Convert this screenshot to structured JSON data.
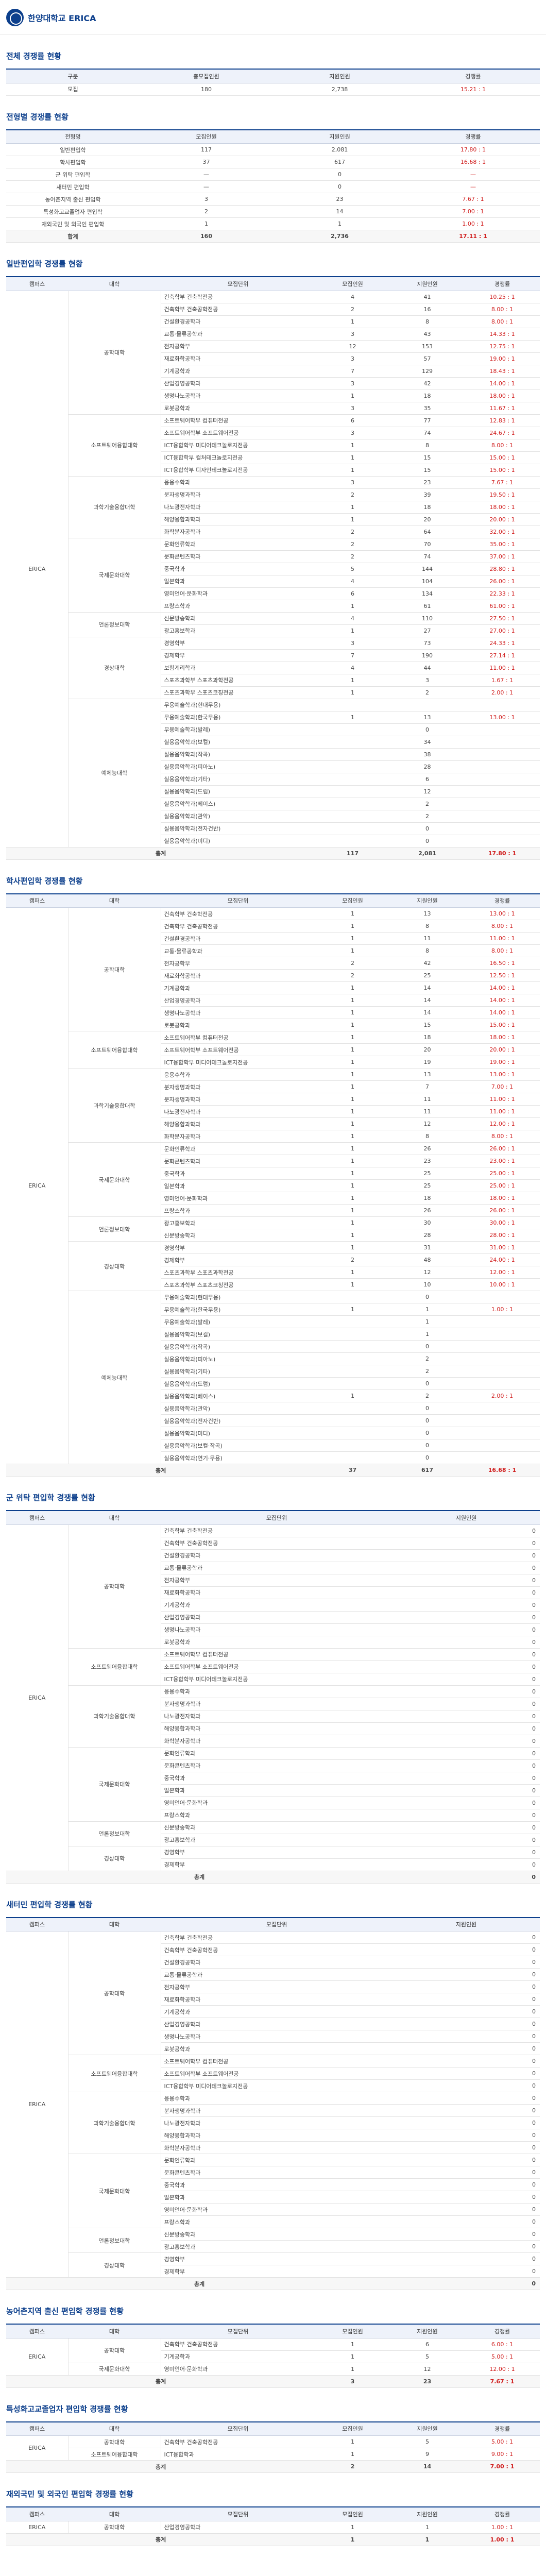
{
  "brand": {
    "name": "한양대학교 ERICA"
  },
  "s1": {
    "title": "전체 경쟁률 현황",
    "headers": [
      "구분",
      "총모집인원",
      "지원인원",
      "경쟁률"
    ],
    "rows": [
      [
        "모집",
        "180",
        "2,738",
        "15.21 : 1"
      ]
    ]
  },
  "s2": {
    "title": "전형별 경쟁률 현황",
    "headers": [
      "전형명",
      "모집인원",
      "지원인원",
      "경쟁률"
    ],
    "rows": [
      [
        "일반편입학",
        "117",
        "2,081",
        "17.80 : 1"
      ],
      [
        "학사편입학",
        "37",
        "617",
        "16.68 : 1"
      ],
      [
        "군 위탁 편입학",
        "—",
        "0",
        "—"
      ],
      [
        "새터민 편입학",
        "—",
        "0",
        "—"
      ],
      [
        "농어촌지역 출신 편입학",
        "3",
        "23",
        "7.67 : 1"
      ],
      [
        "특성화고교졸업자 편입학",
        "2",
        "14",
        "7.00 : 1"
      ],
      [
        "재외국민 및 외국인 편입학",
        "1",
        "1",
        "1.00 : 1"
      ]
    ],
    "total": [
      "합계",
      "160",
      "2,736",
      "17.11 : 1"
    ]
  },
  "s3": {
    "title": "일반편입학 경쟁률 현황",
    "headers": [
      "캠퍼스",
      "대학",
      "모집단위",
      "모집인원",
      "지원인원",
      "경쟁률"
    ]
  },
  "s4": {
    "title": "학사편입학 경쟁률 현황",
    "headers": [
      "캠퍼스",
      "대학",
      "모집단위",
      "모집인원",
      "지원인원",
      "경쟁률"
    ]
  },
  "s5": {
    "title": "군 위탁 편입학 경쟁률 현황",
    "headers": [
      "캠퍼스",
      "대학",
      "모집단위",
      "지원인원"
    ]
  },
  "s6": {
    "title": "새터민 편입학 경쟁률 현황",
    "headers": [
      "캠퍼스",
      "대학",
      "모집단위",
      "지원인원"
    ]
  },
  "s7": {
    "title": "농어촌지역 출신 편입학 경쟁률 현황",
    "headers": [
      "캠퍼스",
      "대학",
      "모집단위",
      "모집인원",
      "지원인원",
      "경쟁률"
    ],
    "rows": [
      [
        "ERICA",
        "공학대학",
        "건축학부 건축공학전공",
        "1",
        "6",
        "6.00 : 1"
      ],
      [
        "",
        "",
        "기계공학과",
        "1",
        "5",
        "5.00 : 1"
      ],
      [
        "",
        "국제문화대학",
        "영미언어·문화학과",
        "1",
        "12",
        "12.00 : 1"
      ]
    ],
    "total": [
      "총계",
      "",
      "",
      "3",
      "23",
      "7.67 : 1"
    ]
  },
  "s8": {
    "title": "특성화고교졸업자 편입학 경쟁률 현황",
    "headers": [
      "캠퍼스",
      "대학",
      "모집단위",
      "모집인원",
      "지원인원",
      "경쟁률"
    ],
    "rows": [
      [
        "ERICA",
        "공학대학",
        "건축학부 건축공학전공",
        "1",
        "5",
        "5.00 : 1"
      ],
      [
        "",
        "소프트웨어융합대학",
        "ICT융합학과",
        "1",
        "9",
        "9.00 : 1"
      ]
    ],
    "total": [
      "총계",
      "",
      "",
      "2",
      "14",
      "7.00 : 1"
    ]
  },
  "s9": {
    "title": "재외국민 및 외국인 편입학 경쟁률 현황",
    "headers": [
      "캠퍼스",
      "대학",
      "모집단위",
      "모집인원",
      "지원인원",
      "경쟁률"
    ],
    "rows": [
      [
        "ERICA",
        "공학대학",
        "산업경영공학과",
        "1",
        "1",
        "1.00 : 1"
      ]
    ],
    "total": [
      "총계",
      "",
      "",
      "1",
      "1",
      "1.00 : 1"
    ]
  },
  "campus": "ERICA",
  "total_label": "총계",
  "general": [
    [
      "공학대학",
      "건축학부 건축학전공",
      "4",
      "41",
      "10.25 : 1"
    ],
    [
      "",
      "건축학부 건축공학전공",
      "2",
      "16",
      "8.00 : 1"
    ],
    [
      "",
      "건설환경공학과",
      "1",
      "8",
      "8.00 : 1"
    ],
    [
      "",
      "교통·물류공학과",
      "3",
      "43",
      "14.33 : 1"
    ],
    [
      "",
      "전자공학부",
      "12",
      "153",
      "12.75 : 1"
    ],
    [
      "",
      "재료화학공학과",
      "3",
      "57",
      "19.00 : 1"
    ],
    [
      "",
      "기계공학과",
      "7",
      "129",
      "18.43 : 1"
    ],
    [
      "",
      "산업경영공학과",
      "3",
      "42",
      "14.00 : 1"
    ],
    [
      "",
      "생명나노공학과",
      "1",
      "18",
      "18.00 : 1"
    ],
    [
      "",
      "로봇공학과",
      "3",
      "35",
      "11.67 : 1"
    ],
    [
      "소프트웨어융합대학",
      "소프트웨어학부 컴퓨터전공",
      "6",
      "77",
      "12.83 : 1"
    ],
    [
      "",
      "소프트웨어학부 소프트웨어전공",
      "3",
      "74",
      "24.67 : 1"
    ],
    [
      "",
      "ICT융합학부 미디어테크놀로지전공",
      "1",
      "8",
      "8.00 : 1"
    ],
    [
      "",
      "ICT융합학부 컬처테크놀로지전공",
      "1",
      "15",
      "15.00 : 1"
    ],
    [
      "",
      "ICT융합학부 디자인테크놀로지전공",
      "1",
      "15",
      "15.00 : 1"
    ],
    [
      "과학기술융합대학",
      "응용수학과",
      "3",
      "23",
      "7.67 : 1"
    ],
    [
      "",
      "분자생명과학과",
      "2",
      "39",
      "19.50 : 1"
    ],
    [
      "",
      "나노광전자학과",
      "1",
      "18",
      "18.00 : 1"
    ],
    [
      "",
      "해양융합과학과",
      "1",
      "20",
      "20.00 : 1"
    ],
    [
      "",
      "화학분자공학과",
      "2",
      "64",
      "32.00 : 1"
    ],
    [
      "국제문화대학",
      "문화인류학과",
      "2",
      "70",
      "35.00 : 1"
    ],
    [
      "",
      "문화콘텐츠학과",
      "2",
      "74",
      "37.00 : 1"
    ],
    [
      "",
      "중국학과",
      "5",
      "144",
      "28.80 : 1"
    ],
    [
      "",
      "일본학과",
      "4",
      "104",
      "26.00 : 1"
    ],
    [
      "",
      "영미언어·문화학과",
      "6",
      "134",
      "22.33 : 1"
    ],
    [
      "",
      "프랑스학과",
      "1",
      "61",
      "61.00 : 1"
    ],
    [
      "언론정보대학",
      "신문방송학과",
      "4",
      "110",
      "27.50 : 1"
    ],
    [
      "",
      "광고홍보학과",
      "1",
      "27",
      "27.00 : 1"
    ],
    [
      "경상대학",
      "경영학부",
      "3",
      "73",
      "24.33 : 1"
    ],
    [
      "",
      "경제학부",
      "7",
      "190",
      "27.14 : 1"
    ],
    [
      "",
      "보험계리학과",
      "4",
      "44",
      "11.00 : 1"
    ],
    [
      "",
      "스포츠과학부 스포츠과학전공",
      "1",
      "3",
      "1.67 : 1"
    ],
    [
      "",
      "스포츠과학부 스포츠코칭전공",
      "1",
      "2",
      "2.00 : 1"
    ],
    [
      "예체능대학",
      "무용예술학과(현대무용)",
      "",
      "",
      " "
    ],
    [
      "",
      "무용예술학과(한국무용)",
      "1",
      "13",
      "13.00 : 1"
    ],
    [
      "",
      "무용예술학과(발레)",
      "",
      "0",
      ""
    ],
    [
      "",
      "실용음악학과(보컬)",
      "",
      "34",
      ""
    ],
    [
      "",
      "실용음악학과(작곡)",
      "",
      "38",
      ""
    ],
    [
      "",
      "실용음악학과(피아노)",
      "",
      "28",
      ""
    ],
    [
      "",
      "실용음악학과(기타)",
      "",
      "6",
      ""
    ],
    [
      "",
      "실용음악학과(드럼)",
      "",
      "12",
      ""
    ],
    [
      "",
      "실용음악학과(베이스)",
      "",
      "2",
      ""
    ],
    [
      "",
      "실용음악학과(관악)",
      "",
      "2",
      ""
    ],
    [
      "",
      "실용음악학과(전자건반)",
      "",
      "0",
      ""
    ],
    [
      "",
      "실용음악학과(미디)",
      "",
      "0",
      ""
    ]
  ],
  "general_total": [
    "117",
    "2,081",
    "17.80 : 1"
  ],
  "bachelor": [
    [
      "공학대학",
      "건축학부 건축학전공",
      "1",
      "13",
      "13.00 : 1"
    ],
    [
      "",
      "건축학부 건축공학전공",
      "1",
      "8",
      "8.00 : 1"
    ],
    [
      "",
      "건설환경공학과",
      "1",
      "11",
      "11.00 : 1"
    ],
    [
      "",
      "교통·물류공학과",
      "1",
      "8",
      "8.00 : 1"
    ],
    [
      "",
      "전자공학부",
      "2",
      "42",
      "16.50 : 1"
    ],
    [
      "",
      "재료화학공학과",
      "2",
      "25",
      "12.50 : 1"
    ],
    [
      "",
      "기계공학과",
      "1",
      "14",
      "14.00 : 1"
    ],
    [
      "",
      "산업경영공학과",
      "1",
      "14",
      "14.00 : 1"
    ],
    [
      "",
      "생명나노공학과",
      "1",
      "14",
      "14.00 : 1"
    ],
    [
      "",
      "로봇공학과",
      "1",
      "15",
      "15.00 : 1"
    ],
    [
      "소프트웨어융합대학",
      "소프트웨어학부 컴퓨터전공",
      "1",
      "18",
      "18.00 : 1"
    ],
    [
      "",
      "소프트웨어학부 소프트웨어전공",
      "1",
      "20",
      "20.00 : 1"
    ],
    [
      "",
      "ICT융합학부 미디어테크놀로지전공",
      "1",
      "19",
      "19.00 : 1"
    ],
    [
      "과학기술융합대학",
      "응용수학과",
      "1",
      "13",
      "13.00 : 1"
    ],
    [
      "",
      "분자생명과학과",
      "1",
      "7",
      "7.00 : 1"
    ],
    [
      "",
      "분자생명과학과",
      "1",
      "11",
      "11.00 : 1"
    ],
    [
      "",
      "나노광전자학과",
      "1",
      "11",
      "11.00 : 1"
    ],
    [
      "",
      "해양융합과학과",
      "1",
      "12",
      "12.00 : 1"
    ],
    [
      "",
      "화학분자공학과",
      "1",
      "8",
      "8.00 : 1"
    ],
    [
      "국제문화대학",
      "문화인류학과",
      "1",
      "26",
      "26.00 : 1"
    ],
    [
      "",
      "문화콘텐츠학과",
      "1",
      "23",
      "23.00 : 1"
    ],
    [
      "",
      "중국학과",
      "1",
      "25",
      "25.00 : 1"
    ],
    [
      "",
      "일본학과",
      "1",
      "25",
      "25.00 : 1"
    ],
    [
      "",
      "영미언어·문화학과",
      "1",
      "18",
      "18.00 : 1"
    ],
    [
      "",
      "프랑스학과",
      "1",
      "26",
      "26.00 : 1"
    ],
    [
      "언론정보대학",
      "광고홍보학과",
      "1",
      "30",
      "30.00 : 1"
    ],
    [
      "",
      "신문방송학과",
      "1",
      "28",
      "28.00 : 1"
    ],
    [
      "경상대학",
      "경영학부",
      "1",
      "31",
      "31.00 : 1"
    ],
    [
      "",
      "경제학부",
      "2",
      "48",
      "24.00 : 1"
    ],
    [
      "",
      "스포츠과학부 스포츠과학전공",
      "1",
      "12",
      "12.00 : 1"
    ],
    [
      "",
      "스포츠과학부 스포츠코칭전공",
      "1",
      "10",
      "10.00 : 1"
    ],
    [
      "예체능대학",
      "무용예술학과(현대무용)",
      "",
      "0",
      ""
    ],
    [
      "",
      "무용예술학과(한국무용)",
      "1",
      "1",
      "1.00 : 1"
    ],
    [
      "",
      "무용예술학과(발레)",
      "",
      "1",
      ""
    ],
    [
      "",
      "실용음악학과(보컬)",
      "",
      "1",
      ""
    ],
    [
      "",
      "실용음악학과(작곡)",
      "",
      "0",
      ""
    ],
    [
      "",
      "실용음악학과(피아노)",
      "",
      "2",
      ""
    ],
    [
      "",
      "실용음악학과(기타)",
      "",
      "2",
      ""
    ],
    [
      "",
      "실용음악학과(드럼)",
      "",
      "0",
      ""
    ],
    [
      "",
      "실용음악학과(베이스)",
      "1",
      "2",
      "2.00 : 1"
    ],
    [
      "",
      "실용음악학과(관악)",
      "",
      "0",
      ""
    ],
    [
      "",
      "실용음악학과(전자건반)",
      "",
      "0",
      ""
    ],
    [
      "",
      "실용음악학과(미디)",
      "",
      "0",
      ""
    ],
    [
      "",
      "실용음악학과(보컬·작곡)",
      "",
      "0",
      ""
    ],
    [
      "",
      "실용음악학과(연기·무용)",
      "",
      "0",
      ""
    ]
  ],
  "bachelor_total": [
    "37",
    "617",
    "16.68 : 1"
  ],
  "military": [
    [
      "공학대학",
      "건축학부 건축학전공",
      "0"
    ],
    [
      "",
      "건축학부 건축공학전공",
      "0"
    ],
    [
      "",
      "건설환경공학과",
      "0"
    ],
    [
      "",
      "교통·물류공학과",
      "0"
    ],
    [
      "",
      "전자공학부",
      "0"
    ],
    [
      "",
      "재료화학공학과",
      "0"
    ],
    [
      "",
      "기계공학과",
      "0"
    ],
    [
      "",
      "산업경영공학과",
      "0"
    ],
    [
      "",
      "생명나노공학과",
      "0"
    ],
    [
      "",
      "로봇공학과",
      "0"
    ],
    [
      "소프트웨어융합대학",
      "소프트웨어학부 컴퓨터전공",
      "0"
    ],
    [
      "",
      "소프트웨어학부 소프트웨어전공",
      "0"
    ],
    [
      "",
      "ICT융합학부 미디어테크놀로지전공",
      "0"
    ],
    [
      "과학기술융합대학",
      "응용수학과",
      "0"
    ],
    [
      "",
      "분자생명과학과",
      "0"
    ],
    [
      "",
      "나노광전자학과",
      "0"
    ],
    [
      "",
      "해양융합과학과",
      "0"
    ],
    [
      "",
      "화학분자공학과",
      "0"
    ],
    [
      "국제문화대학",
      "문화인류학과",
      "0"
    ],
    [
      "",
      "문화콘텐츠학과",
      "0"
    ],
    [
      "",
      "중국학과",
      "0"
    ],
    [
      "",
      "일본학과",
      "0"
    ],
    [
      "",
      "영미언어·문화학과",
      "0"
    ],
    [
      "",
      "프랑스학과",
      "0"
    ],
    [
      "언론정보대학",
      "신문방송학과",
      "0"
    ],
    [
      "",
      "광고홍보학과",
      "0"
    ],
    [
      "경상대학",
      "경영학부",
      "0"
    ],
    [
      "",
      "경제학부",
      "0"
    ]
  ],
  "military_total": "0",
  "refugee": [
    [
      "공학대학",
      "건축학부 건축학전공",
      "0"
    ],
    [
      "",
      "건축학부 건축공학전공",
      "0"
    ],
    [
      "",
      "건설환경공학과",
      "0"
    ],
    [
      "",
      "교통·물류공학과",
      "0"
    ],
    [
      "",
      "전자공학부",
      "0"
    ],
    [
      "",
      "재료화학공학과",
      "0"
    ],
    [
      "",
      "기계공학과",
      "0"
    ],
    [
      "",
      "산업경영공학과",
      "0"
    ],
    [
      "",
      "생명나노공학과",
      "0"
    ],
    [
      "",
      "로봇공학과",
      "0"
    ],
    [
      "소프트웨어융합대학",
      "소프트웨어학부 컴퓨터전공",
      "0"
    ],
    [
      "",
      "소프트웨어학부 소프트웨어전공",
      "0"
    ],
    [
      "",
      "ICT융합학부 미디어테크놀로지전공",
      "0"
    ],
    [
      "과학기술융합대학",
      "응용수학과",
      "0"
    ],
    [
      "",
      "분자생명과학과",
      "0"
    ],
    [
      "",
      "나노광전자학과",
      "0"
    ],
    [
      "",
      "해양융합과학과",
      "0"
    ],
    [
      "",
      "화학분자공학과",
      "0"
    ],
    [
      "국제문화대학",
      "문화인류학과",
      "0"
    ],
    [
      "",
      "문화콘텐츠학과",
      "0"
    ],
    [
      "",
      "중국학과",
      "0"
    ],
    [
      "",
      "일본학과",
      "0"
    ],
    [
      "",
      "영미언어·문화학과",
      "0"
    ],
    [
      "",
      "프랑스학과",
      "0"
    ],
    [
      "언론정보대학",
      "신문방송학과",
      "0"
    ],
    [
      "",
      "광고홍보학과",
      "0"
    ],
    [
      "경상대학",
      "경영학부",
      "0"
    ],
    [
      "",
      "경제학부",
      "0"
    ]
  ],
  "refugee_total": "0"
}
